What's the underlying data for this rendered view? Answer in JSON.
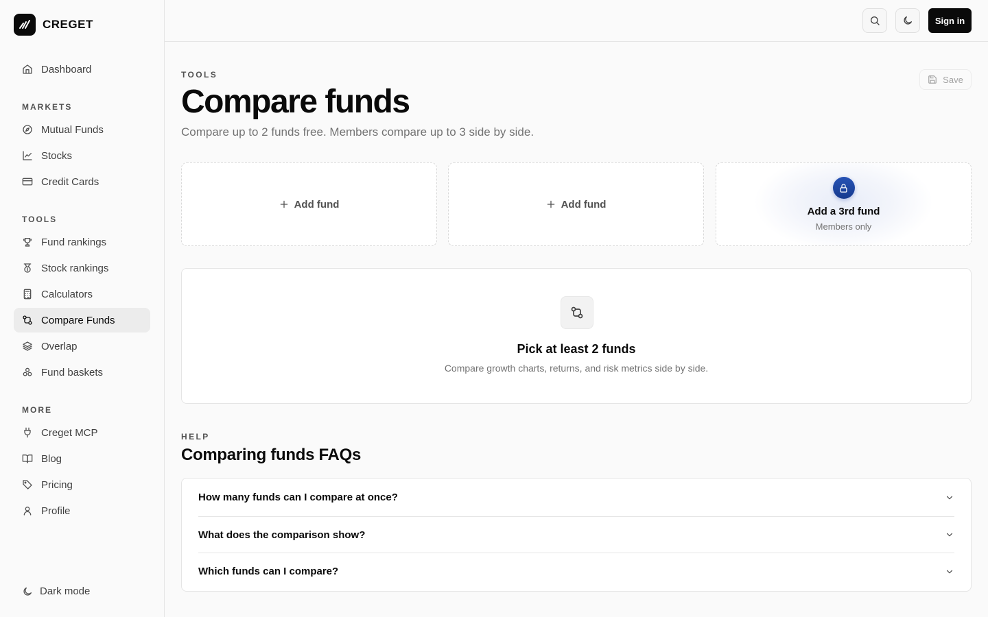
{
  "brand": {
    "name": "CREGET"
  },
  "sidebar": {
    "top_items": [
      {
        "label": "Dashboard",
        "icon": "home-icon"
      }
    ],
    "sections": [
      {
        "title": "MARKETS",
        "items": [
          {
            "label": "Mutual Funds",
            "icon": "compass-icon"
          },
          {
            "label": "Stocks",
            "icon": "line-chart-icon"
          },
          {
            "label": "Credit Cards",
            "icon": "credit-card-icon"
          }
        ]
      },
      {
        "title": "TOOLS",
        "items": [
          {
            "label": "Fund rankings",
            "icon": "trophy-icon"
          },
          {
            "label": "Stock rankings",
            "icon": "medal-icon"
          },
          {
            "label": "Calculators",
            "icon": "calculator-icon"
          },
          {
            "label": "Compare Funds",
            "icon": "compare-icon",
            "active": true
          },
          {
            "label": "Overlap",
            "icon": "layers-icon"
          },
          {
            "label": "Fund baskets",
            "icon": "basket-icon"
          }
        ]
      },
      {
        "title": "MORE",
        "items": [
          {
            "label": "Creget MCP",
            "icon": "plug-icon"
          },
          {
            "label": "Blog",
            "icon": "book-icon"
          },
          {
            "label": "Pricing",
            "icon": "tag-icon"
          },
          {
            "label": "Profile",
            "icon": "user-icon"
          }
        ]
      }
    ],
    "dark_mode_label": "Dark mode"
  },
  "topbar": {
    "sign_in_label": "Sign in"
  },
  "main": {
    "eyebrow": "TOOLS",
    "title": "Compare funds",
    "subtitle": "Compare up to 2 funds free. Members compare up to 3 side by side.",
    "save_label": "Save",
    "slots": [
      {
        "label": "Add fund"
      },
      {
        "label": "Add fund"
      }
    ],
    "locked_slot": {
      "title": "Add a 3rd fund",
      "subtitle": "Members only"
    },
    "empty_state": {
      "title": "Pick at least 2 funds",
      "subtitle": "Compare growth charts, returns, and risk metrics side by side."
    },
    "help": {
      "eyebrow": "HELP",
      "title": "Comparing funds FAQs",
      "faqs": [
        {
          "question": "How many funds can I compare at once?"
        },
        {
          "question": "What does the comparison show?"
        },
        {
          "question": "Which funds can I compare?"
        }
      ]
    }
  },
  "colors": {
    "accent_dark": "#0a0a0a",
    "locked_blue": "#1e40af"
  }
}
